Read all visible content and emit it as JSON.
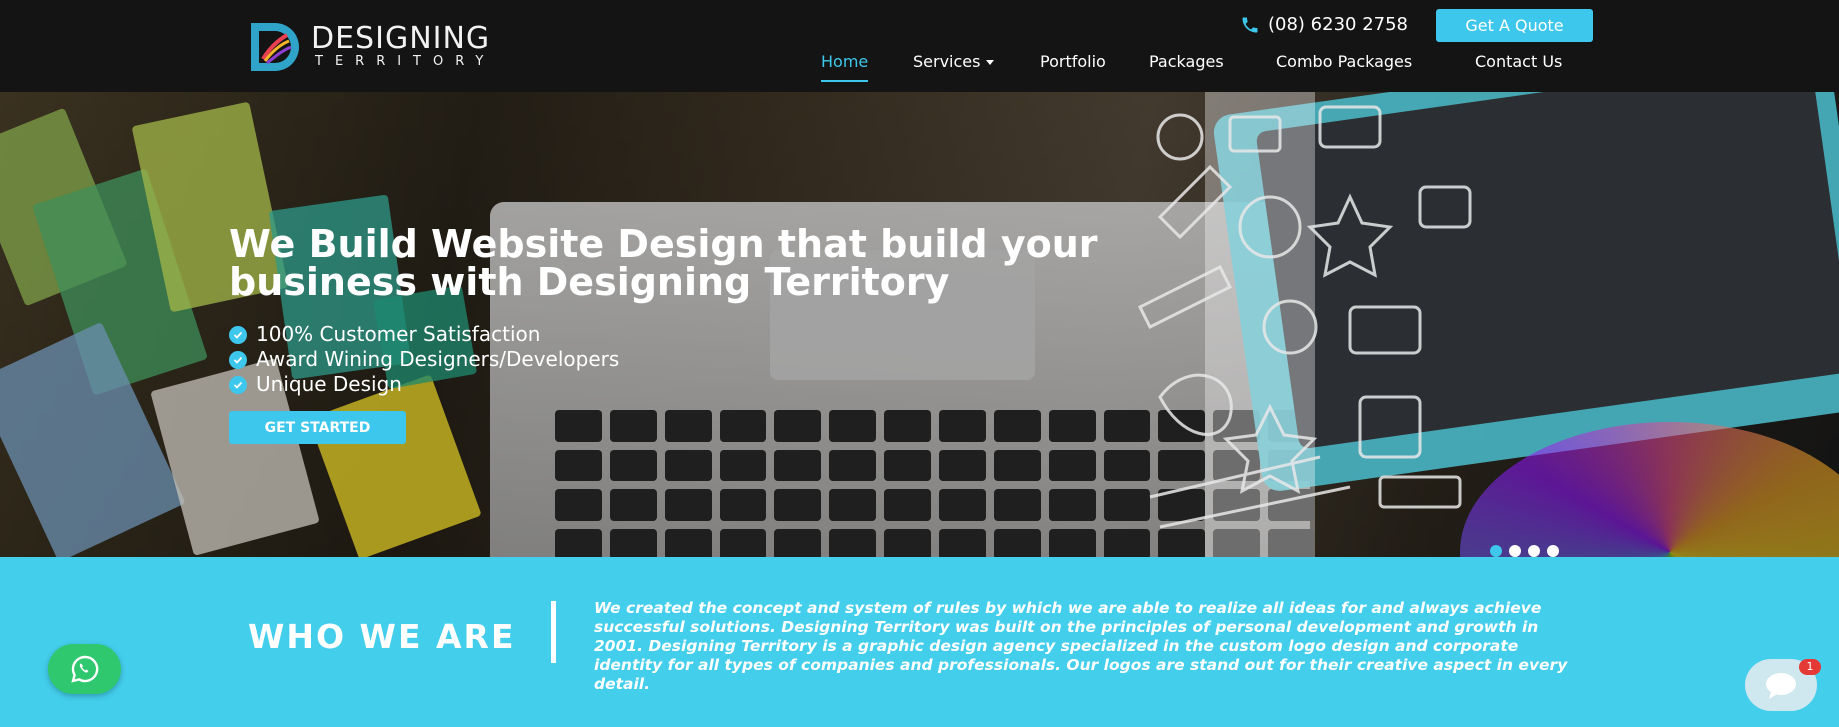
{
  "brand": {
    "name_line1": "DESIGNING",
    "name_line2": "TERRITORY"
  },
  "header": {
    "phone": "(08) 6230 2758",
    "quote_button": "Get A Quote",
    "nav": [
      {
        "label": "Home",
        "active": true
      },
      {
        "label": "Services",
        "dropdown": true
      },
      {
        "label": "Portfolio"
      },
      {
        "label": "Packages"
      },
      {
        "label": "Combo Packages"
      },
      {
        "label": "Contact Us"
      }
    ]
  },
  "hero": {
    "title_line1": "We Build Website Design that build your",
    "title_line2": "business with Designing Territory",
    "bullets": [
      "100% Customer Satisfaction",
      "Award Wining Designers/Developers",
      "Unique Design"
    ],
    "cta": "GET STARTED",
    "slide_count": 4,
    "active_slide": 1
  },
  "who": {
    "title": "WHO WE ARE",
    "text": "We created the concept and system of rules by which we are able to realize all ideas for and always achieve successful solutions. Designing Territory was built on the principles of personal development and growth in 2001. Designing Territory is a graphic design agency specialized in the custom logo design and corporate identity for all types of companies and professionals. Our logos are stand out for their creative aspect in every detail."
  },
  "chat": {
    "badge": "1"
  },
  "colors": {
    "accent": "#3ec7ec",
    "header_bg": "#141414",
    "who_bg": "#43ceec",
    "whatsapp": "#2fc86e"
  }
}
